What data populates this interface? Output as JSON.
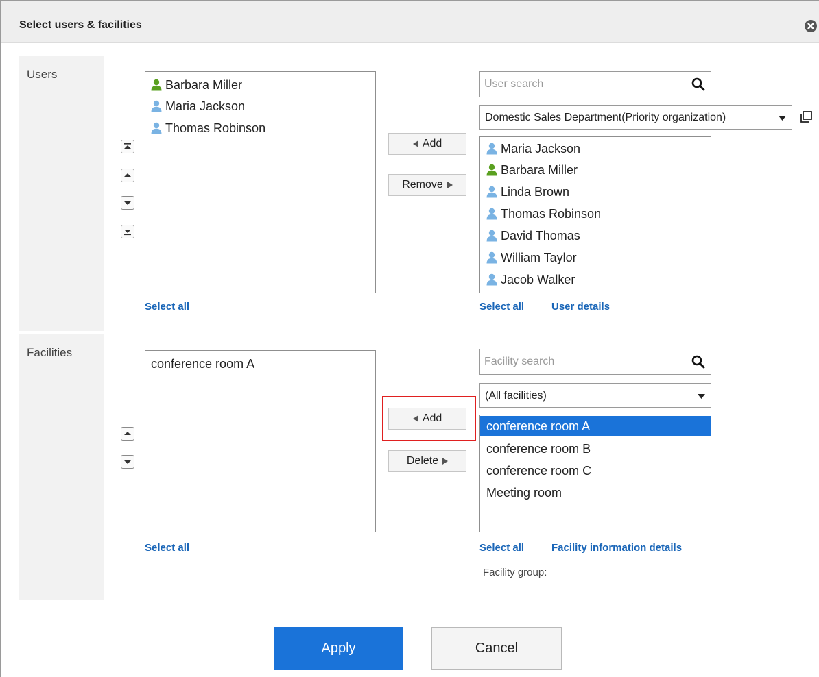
{
  "dialog": {
    "title": "Select users & facilities"
  },
  "users": {
    "section_label": "Users",
    "selected": [
      {
        "name": "Barbara Miller",
        "icon": "user-icon-green"
      },
      {
        "name": "Maria Jackson",
        "icon": "user-icon-blue"
      },
      {
        "name": "Thomas Robinson",
        "icon": "user-icon-blue"
      }
    ],
    "select_all_left": "Select all",
    "add_label": "Add",
    "remove_label": "Remove",
    "search_placeholder": "User search",
    "org_select_value": "Domestic Sales Department(Priority organization)",
    "candidates": [
      {
        "name": "Maria Jackson",
        "icon": "user-icon-blue"
      },
      {
        "name": "Barbara Miller",
        "icon": "user-icon-green"
      },
      {
        "name": "Linda Brown",
        "icon": "user-icon-blue"
      },
      {
        "name": "Thomas Robinson",
        "icon": "user-icon-blue"
      },
      {
        "name": "David Thomas",
        "icon": "user-icon-blue"
      },
      {
        "name": "William Taylor",
        "icon": "user-icon-blue"
      },
      {
        "name": "Jacob Walker",
        "icon": "user-icon-blue"
      }
    ],
    "select_all_right": "Select all",
    "details_link": "User details"
  },
  "facilities": {
    "section_label": "Facilities",
    "selected": [
      "conference room A"
    ],
    "select_all_left": "Select all",
    "add_label": "Add",
    "delete_label": "Delete",
    "search_placeholder": "Facility search",
    "group_select_value": "(All facilities)",
    "candidates": [
      {
        "name": "conference room A",
        "selected": true
      },
      {
        "name": "conference room B",
        "selected": false
      },
      {
        "name": "conference room C",
        "selected": false
      },
      {
        "name": "Meeting room",
        "selected": false
      }
    ],
    "select_all_right": "Select all",
    "details_link": "Facility information details",
    "group_label": "Facility group:"
  },
  "footer": {
    "apply_label": "Apply",
    "cancel_label": "Cancel"
  },
  "colors": {
    "accent": "#1a73d9",
    "link": "#1a66b8",
    "user_green": "#5aa020",
    "user_blue": "#7ab3e3",
    "highlight": "#e02020"
  }
}
